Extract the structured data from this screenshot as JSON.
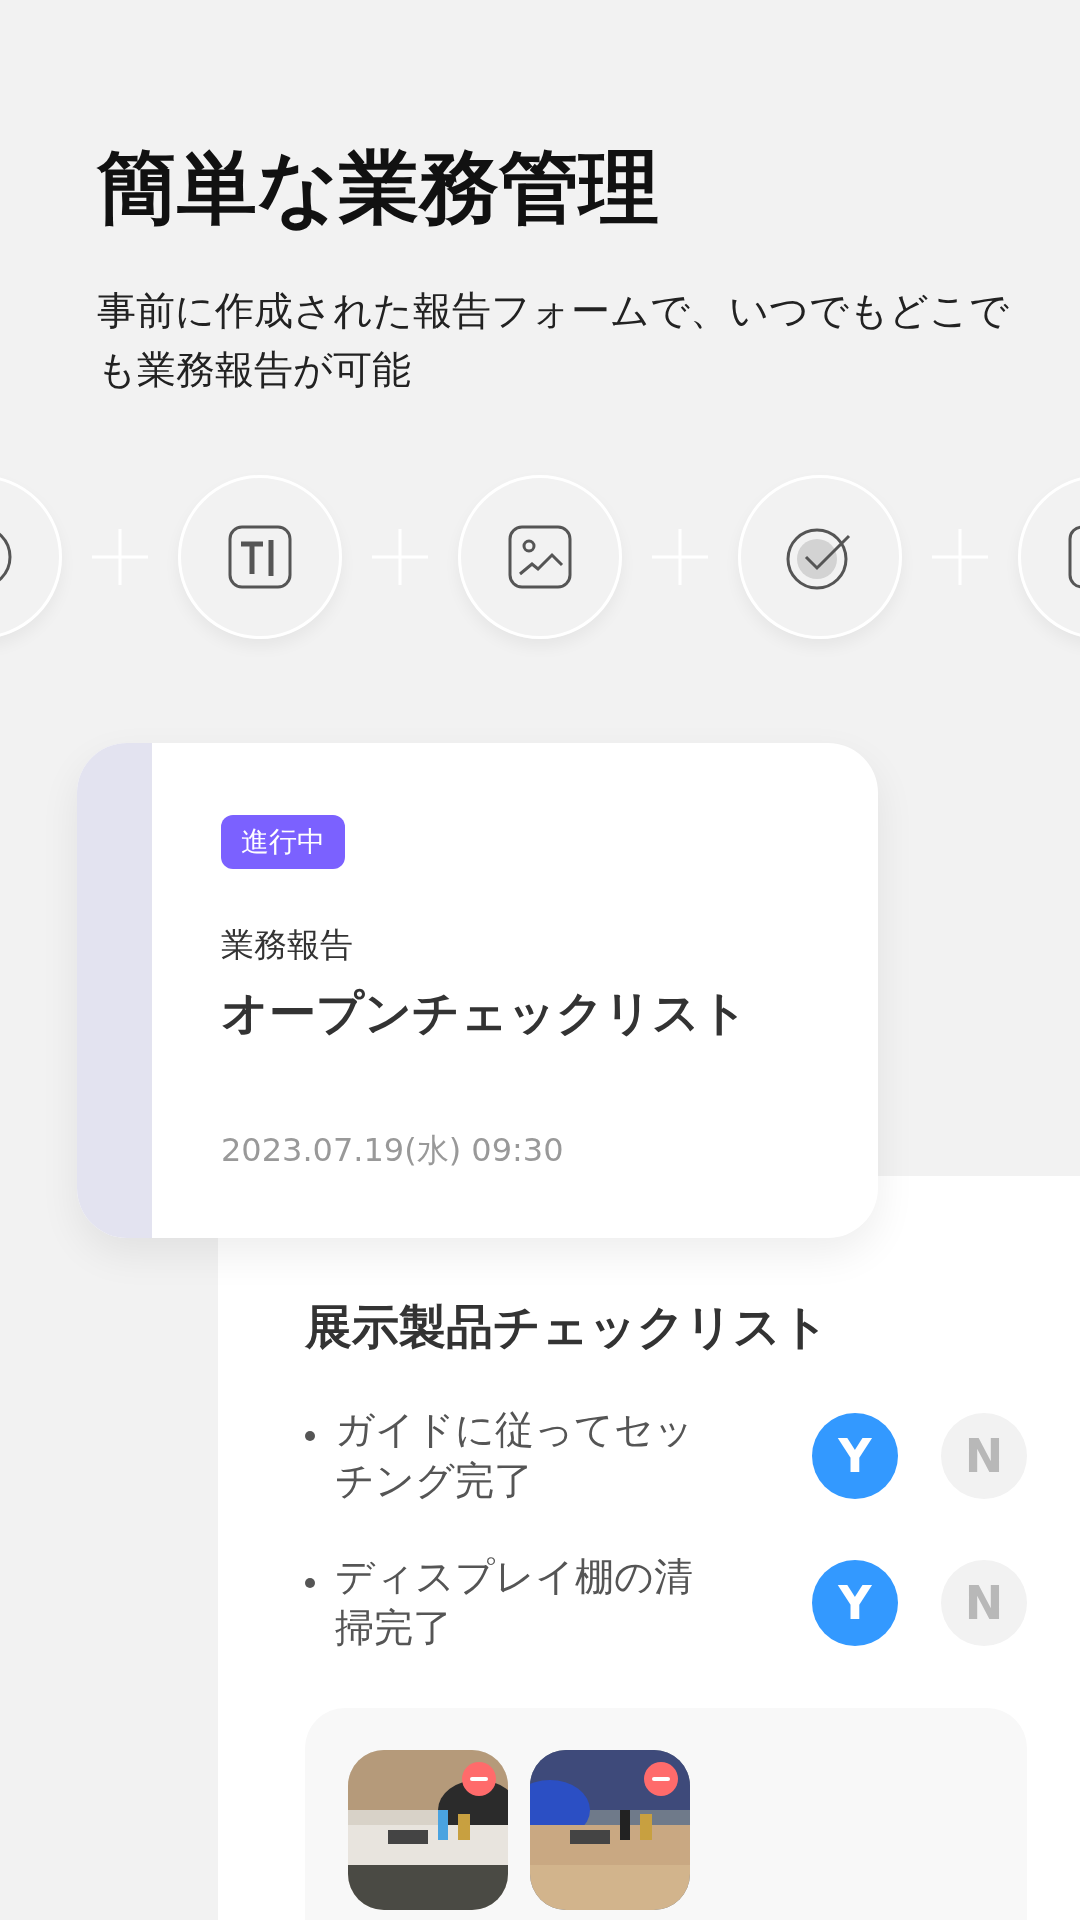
{
  "heading": "簡単な業務管理",
  "subtitle": "事前に作成された報告フォームで、いつでもどこでも業務報告が可能",
  "report_card": {
    "status": "進行中",
    "category": "業務報告",
    "title": "オープンチェックリスト",
    "date": "2023.07.19(水) 09:30"
  },
  "checklist": {
    "title": "展示製品チェックリスト",
    "items": [
      {
        "text": "ガイドに従ってセッチング完了",
        "options": [
          {
            "label": "Y",
            "selected": true
          },
          {
            "label": "N",
            "selected": false
          }
        ]
      },
      {
        "text": "ディスプレイ棚の清掃完了",
        "options": [
          {
            "label": "Y",
            "selected": true
          },
          {
            "label": "N",
            "selected": false
          }
        ]
      }
    ]
  }
}
